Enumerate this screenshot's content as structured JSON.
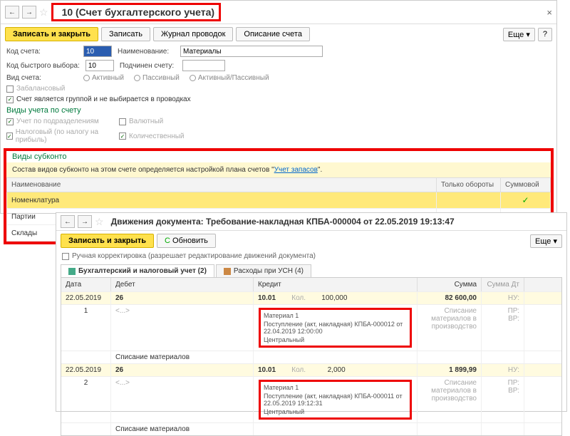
{
  "top": {
    "title": "10 (Счет бухгалтерского учета)",
    "save_close": "Записать и закрыть",
    "save": "Записать",
    "journal": "Журнал проводок",
    "desc": "Описание счета",
    "more": "Еще",
    "help": "?",
    "f_code_lbl": "Код счета:",
    "f_code_val": "10",
    "f_name_lbl": "Наименование:",
    "f_name_val": "Материалы",
    "f_fast_lbl": "Код быстрого выбора:",
    "f_fast_val": "10",
    "f_parent_lbl": "Подчинен счету:",
    "f_type_lbl": "Вид счета:",
    "r_active": "Активный",
    "r_passive": "Пассивный",
    "r_ap": "Активный/Пассивный",
    "chk_offbal": "Забалансовый",
    "chk_group": "Счет является группой и не выбирается в проводках",
    "sec_types": "Виды учета по счету",
    "chk_dept": "Учет по подразделениям",
    "chk_curr": "Валютный",
    "chk_tax": "Налоговый (по налогу на прибыль)",
    "chk_qty": "Количественный",
    "sec_subk": "Виды субконто",
    "info": "Состав видов субконто на этом счете определяется настройкой плана счетов \"",
    "info_link": "Учет запасов",
    "th_name": "Наименование",
    "th_turn": "Только обороты",
    "th_sum": "Суммовой",
    "rows": [
      "Номенклатура",
      "Партии",
      "Склады"
    ]
  },
  "bot": {
    "title": "Движения документа: Требование-накладная КПБА-000004 от 22.05.2019 19:13:47",
    "save_close": "Записать и закрыть",
    "refresh": "Обновить",
    "more": "Еще",
    "manual": "Ручная корректировка (разрешает редактирование движений документа)",
    "tab1": "Бухгалтерский и налоговый учет (2)",
    "tab2": "Расходы при УСН (4)",
    "h_date": "Дата",
    "h_deb": "Дебет",
    "h_kre": "Кредит",
    "h_sum": "Сумма",
    "h_sumd": "Сумма Дт",
    "r1_date": "22.05.2019",
    "r1_deb": "26",
    "r1_kre": "10.01",
    "r1_kol": "Кол.",
    "r1_qty": "100,000",
    "r1_sum": "82 600,00",
    "r1_n": "1",
    "r1_desc": "Списание материалов",
    "r1_desc2": "Списание материалов в производство",
    "r1_mat": "Материал 1",
    "r1_doc": "Поступление (акт, накладная) КПБА-000012 от 22.04.2019 12:00:00",
    "r1_wh": "Центральный",
    "r2_date": "22.05.2019",
    "r2_deb": "26",
    "r2_kre": "10.01",
    "r2_qty": "2,000",
    "r2_sum": "1 899,99",
    "r2_n": "2",
    "r2_desc": "Списание материалов",
    "r2_desc2": "Списание материалов в производство",
    "r2_mat": "Материал 1",
    "r2_doc": "Поступление (акт, накладная) КПБА-000011 от 22.05.2019 19:12:31",
    "r2_wh": "Центральный",
    "nu": "НУ:",
    "pr": "ПР:",
    "vr": "ВР:"
  }
}
